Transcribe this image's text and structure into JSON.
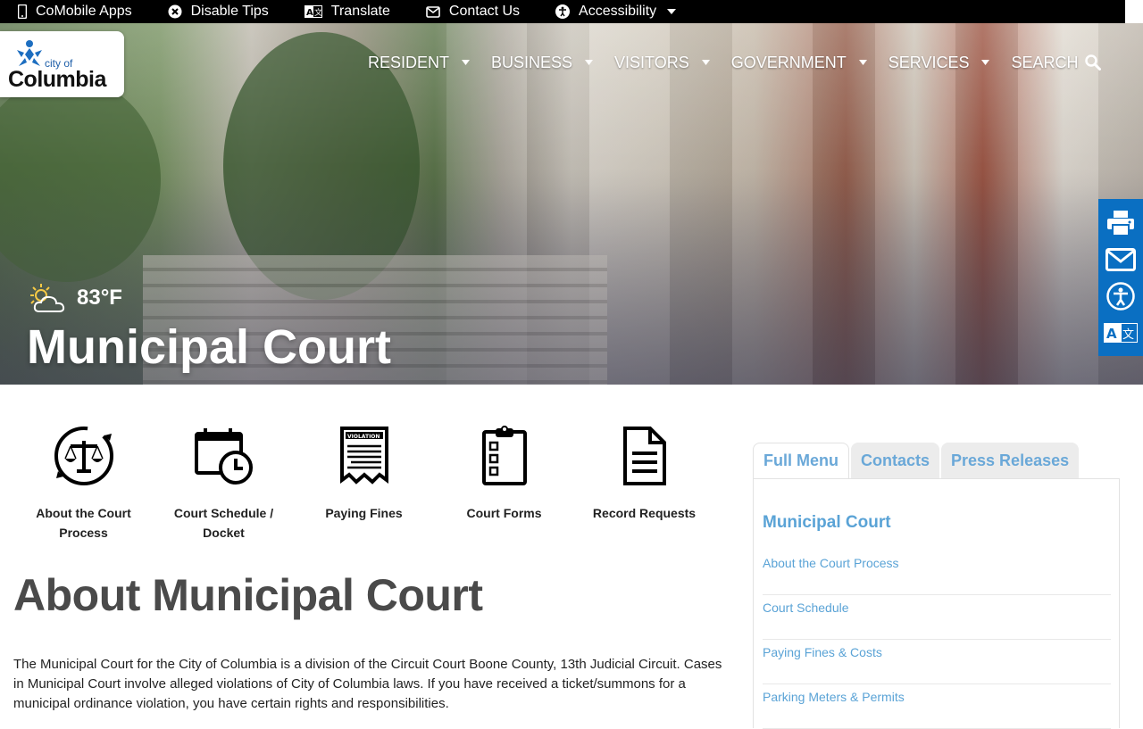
{
  "utility_bar": {
    "items": [
      {
        "label": "CoMobile Apps",
        "icon": "mobile-phone-icon"
      },
      {
        "label": "Disable Tips",
        "icon": "close-circle-icon"
      },
      {
        "label": "Translate",
        "icon": "translate-icon"
      },
      {
        "label": "Contact Us",
        "icon": "envelope-icon"
      },
      {
        "label": "Accessibility",
        "icon": "accessibility-icon"
      }
    ]
  },
  "logo": {
    "small": "city of",
    "name": "Columbia"
  },
  "main_nav": {
    "items": [
      "RESIDENT",
      "BUSINESS",
      "VISITORS",
      "GOVERNMENT",
      "SERVICES"
    ],
    "search_label": "SEARCH"
  },
  "hero": {
    "weather_temp": "83°F",
    "weather_icon": "partly-sunny-icon",
    "title": "Municipal Court"
  },
  "share_bar": {
    "icons": [
      "print-icon",
      "email-icon",
      "accessibility-icon",
      "translate-icon"
    ]
  },
  "quick_links": [
    {
      "label": "About the Court Process",
      "icon": "scales-icon"
    },
    {
      "label": "Court Schedule / Docket",
      "icon": "calendar-clock-icon"
    },
    {
      "label": "Paying Fines",
      "icon": "violation-ticket-icon"
    },
    {
      "label": "Court Forms",
      "icon": "clipboard-icon"
    },
    {
      "label": "Record Requests",
      "icon": "document-icon"
    }
  ],
  "content": {
    "heading": "About Municipal Court",
    "intro": "The Municipal Court for the City of Columbia is a division of the Circuit Court Boone County, 13th Judicial Circuit. Cases in Municipal Court involve alleged violations of City of Columbia laws. If you have received a ticket/summons for a municipal ordinance violation, you have certain rights and responsibilities."
  },
  "sidebar": {
    "tabs": [
      "Full Menu",
      "Contacts",
      "Press Releases"
    ],
    "active_tab": "Full Menu",
    "title": "Municipal Court",
    "items": [
      "About the Court Process",
      "Court Schedule",
      "Paying Fines & Costs",
      "Parking Meters & Permits"
    ]
  },
  "colors": {
    "share_bar": "#0a6fc2",
    "link_blue": "#5aa3d6",
    "utility_bar": "#000000"
  }
}
